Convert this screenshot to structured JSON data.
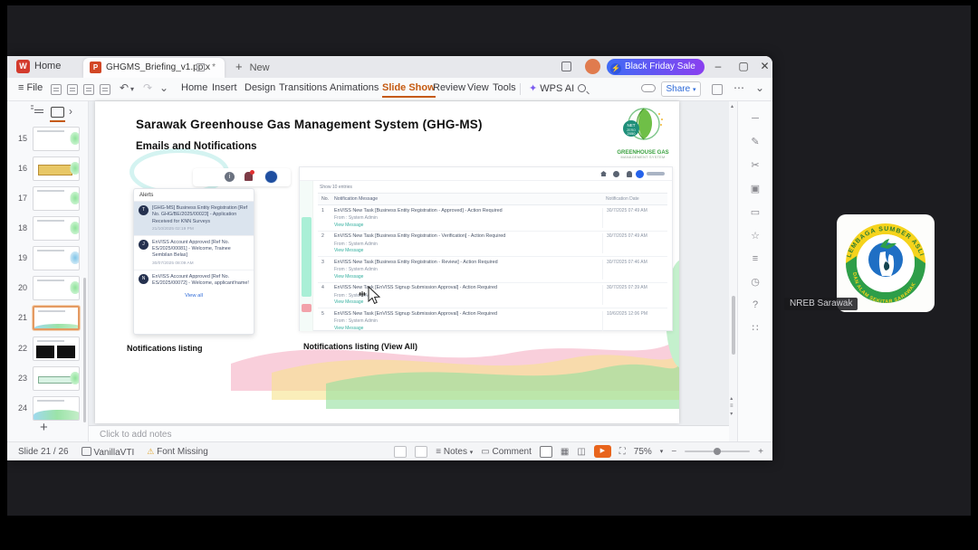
{
  "participant": {
    "label": "NREB Sarawak",
    "logo_arc_top": "LEMBAGA SUMBER ASLI",
    "logo_arc_bottom": "DAN ALAM SEKITAR SARAWAK"
  },
  "titlebar": {
    "home_tab": "Home",
    "document_tab": "GHGMS_Briefing_v1.pptx",
    "modified_marker": "*",
    "new_tab": "New",
    "promo": "Black Friday Sale"
  },
  "menubar": {
    "file": "File",
    "items": [
      "Home",
      "Insert",
      "Design",
      "Transitions",
      "Animations",
      "Slide Show",
      "Review",
      "View",
      "Tools"
    ],
    "wps_ai": "WPS AI",
    "share": "Share"
  },
  "slide_panel": {
    "numbers": [
      "15",
      "16",
      "17",
      "18",
      "19",
      "20",
      "21",
      "22",
      "23",
      "24"
    ],
    "selected": "21"
  },
  "slide": {
    "title": "Sarawak Greenhouse Gas Management System (GHG-MS)",
    "subtitle": "Emails and Notifications",
    "logo": {
      "badge_top": "NET",
      "badge_mid": "ZERO",
      "badge_bottom": "2050",
      "name": "GREENHOUSE GAS",
      "tagline": "MANAGEMENT SYSTEM"
    },
    "caption_left": "Notifications listing",
    "caption_right": "Notifications listing (View All)",
    "alerts": {
      "header": "Alerts",
      "items": [
        {
          "initial": "T",
          "text": "[GHG-MS] Business Entity Registration [Ref No. GHG/BE/2025/00023] - Application Received for KNN Surveys",
          "time": "21/10/2025 02:19 PM"
        },
        {
          "initial": "J",
          "text": "EnVISS Account Approved [Ref No. ES/2025/00081] - Welcome, Trainee Sembilan Belas]",
          "time": "30/07/2025 08:09 AM"
        },
        {
          "initial": "N",
          "text": "EnVISS Account Approved [Ref No. ES/2025/00072] - Welcome, applicant!name!",
          "time": ""
        }
      ],
      "view_all": "View all"
    },
    "table": {
      "show_entries": "Show 10 entries",
      "headers": {
        "no": "No.",
        "message": "Notification Message",
        "date": "Notification Date"
      },
      "rows": [
        {
          "no": "1",
          "message": "EnVISS New Task [Business Entity Registration - Approved] - Action Required",
          "from": "From : System Admin",
          "link": "View Message",
          "date": "30/7/2025 07:49 AM"
        },
        {
          "no": "2",
          "message": "EnVISS New Task [Business Entity Registration - Verification] - Action Required",
          "from": "From : System Admin",
          "link": "View Message",
          "date": "30/7/2025 07:49 AM"
        },
        {
          "no": "3",
          "message": "EnVISS New Task [Business Entity Registration - Review] - Action Required",
          "from": "From : System Admin",
          "link": "View Message",
          "date": "30/7/2025 07:46 AM"
        },
        {
          "no": "4",
          "message": "EnVISS New Task [EnVISS Signup Submission Approval] - Action Required",
          "from": "From : System Admin",
          "link": "View Message",
          "date": "30/7/2025 07:39 AM"
        },
        {
          "no": "5",
          "message": "EnVISS New Task [EnVISS Signup Submission Approval] - Action Required",
          "from": "From : System Admin",
          "link": "View Message",
          "date": "10/6/2025 12:06 PM"
        }
      ]
    }
  },
  "notes_placeholder": "Click to add notes",
  "statusbar": {
    "slide_indicator": "Slide 21 / 26",
    "language": "VanillaVTI",
    "font_missing": "Font Missing",
    "notes_label": "Notes",
    "comment_label": "Comment",
    "zoom": "75%"
  },
  "icons": {
    "wps_logo": "W",
    "ppt_doc": "P",
    "lightning": "⚡",
    "minimize": "–",
    "maximize": "▢",
    "close": "✕",
    "hamburger": "≡",
    "undo": "↶",
    "redo": "↷",
    "caret_down": "▾",
    "chevron_down": "⌄",
    "chevron_right": "›",
    "wps_ai_star": "✦",
    "ellipsis": "⋯",
    "warning": "⚠",
    "play": "▶",
    "add": "+",
    "up_arrow": "▴",
    "tool_icons": [
      "─",
      "✎",
      "✂",
      "▣",
      "▭",
      "☆",
      "≡",
      "◷",
      "?",
      "∷"
    ]
  },
  "colors": {
    "accent_orange": "#c55a11",
    "promo_start": "#3f6bf5",
    "promo_end": "#8a3ff0",
    "teal_link": "#35b0a0",
    "blue_link": "#2f6bd8",
    "play_orange": "#e8641c"
  }
}
